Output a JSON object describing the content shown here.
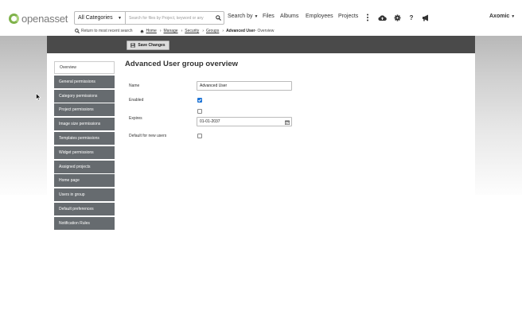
{
  "app": {
    "logo_text": "openasset"
  },
  "search": {
    "category_label": "All Categories",
    "placeholder": "Search for files by Project, keyword or any"
  },
  "nav": {
    "search_by": "Search by",
    "files": "Files",
    "albums": "Albums",
    "employees": "Employees",
    "projects": "Projects"
  },
  "user": {
    "name": "Axomic"
  },
  "breadcrumb": {
    "return_label": "Return to most recent search",
    "home": "Home",
    "manage": "Manage",
    "security": "Security",
    "groups": "Groups",
    "current": "Advanced User",
    "current_suffix": " - Overview"
  },
  "toolbar": {
    "save_label": "Save Changes"
  },
  "sidebar": {
    "items": [
      {
        "label": "Overview",
        "active": true
      },
      {
        "label": "General permissions"
      },
      {
        "label": "Category permissions"
      },
      {
        "label": "Project permissions"
      },
      {
        "label": "Image size permissions"
      },
      {
        "label": "Templates permissions"
      },
      {
        "label": "Widget permissions"
      },
      {
        "label": "Assigned projects"
      },
      {
        "label": "Home page"
      },
      {
        "label": "Users in group"
      },
      {
        "label": "Default preferences"
      },
      {
        "label": "Notification Rules"
      }
    ]
  },
  "form": {
    "title": "Advanced User group overview",
    "name_label": "Name",
    "name_value": "Advanced User",
    "enabled_label": "Enabled",
    "enabled_checked": true,
    "expires_label": "Expires",
    "expires_checked": false,
    "expires_value": "01-01-2037",
    "default_label": "Default for new users",
    "default_checked": false
  },
  "icons": {
    "search": "search-icon",
    "kebab": "more-vertical-icon",
    "upload": "cloud-upload-icon",
    "settings": "gear-icon",
    "help": "question-icon",
    "announce": "megaphone-icon",
    "save": "floppy-disk-icon",
    "calendar": "calendar-icon"
  },
  "colors": {
    "brand_green": "#7fb24a",
    "toolbar_dark": "#4a4a4a",
    "sidebar_item": "#666b6f",
    "checkbox_accent": "#1e74d6"
  }
}
